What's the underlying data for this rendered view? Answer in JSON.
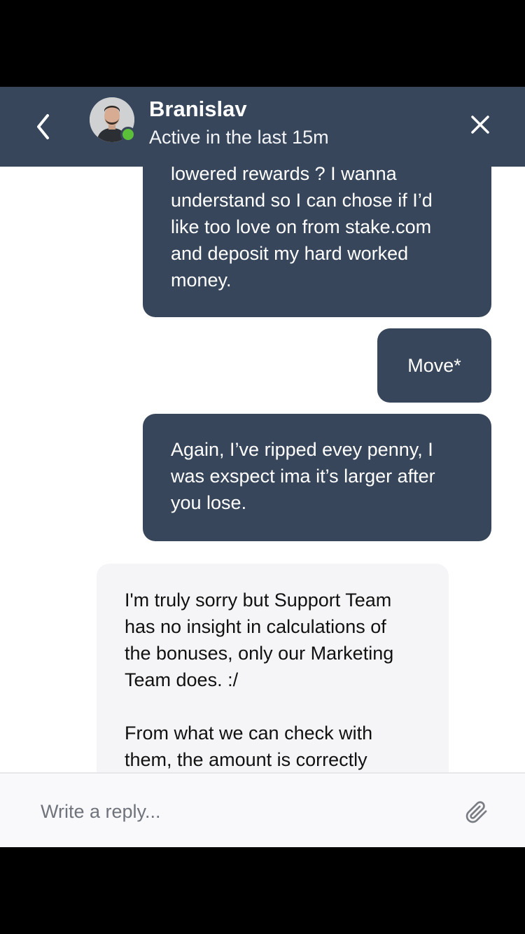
{
  "header": {
    "name": "Branislav",
    "status": "Active in the last 15m",
    "back_icon": "chevron-left-icon",
    "close_icon": "close-icon",
    "status_color": "#5cbf3a",
    "header_color": "#37465a"
  },
  "messages": [
    {
      "direction": "outgoing",
      "text": "lowered rewards ? I wanna\nunderstand so I can chose if I’d\nlike too love on from stake.com\nand deposit my hard worked\nmoney."
    },
    {
      "direction": "outgoing",
      "text": "Move*"
    },
    {
      "direction": "outgoing",
      "text": "Again, I’ve ripped evey penny, I\nwas exspect ima it’s larger after\nyou lose."
    },
    {
      "direction": "incoming",
      "text": "I'm truly sorry but Support Team\nhas no insight in calculations of\nthe bonuses, only our Marketing\nTeam does. :/\n\nFrom what we can check with\nthem, the amount is correctly"
    }
  ],
  "composer": {
    "placeholder": "Write a reply...",
    "value": "",
    "attach_icon": "paperclip-icon"
  }
}
